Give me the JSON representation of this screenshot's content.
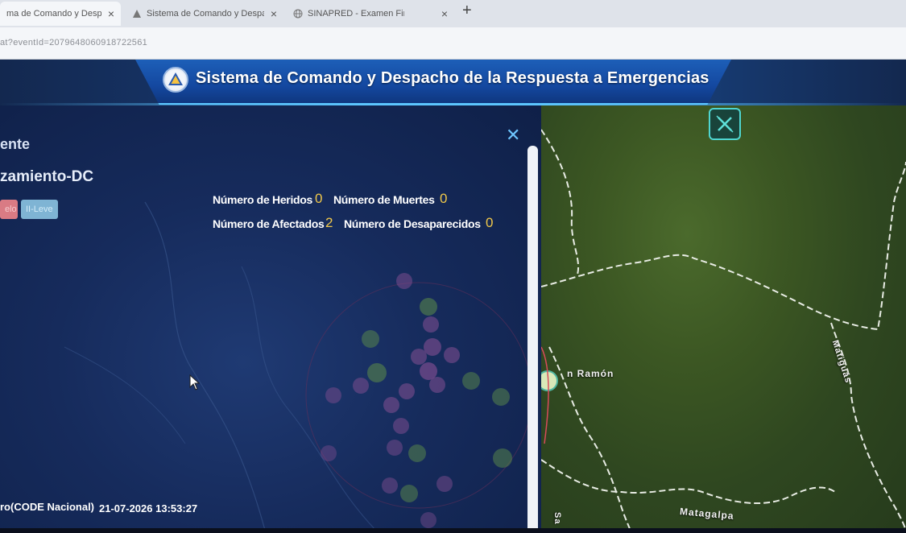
{
  "browser": {
    "tabs": [
      {
        "label": "ma de Comando y Despacho",
        "active": true,
        "favicon": "sinapred-icon"
      },
      {
        "label": "Sistema de Comando y Despacho",
        "active": false,
        "favicon": "sinapred-icon"
      },
      {
        "label": "SINAPRED - Examen Final",
        "active": false,
        "favicon": "globe-icon"
      }
    ],
    "tab_close_glyph": "×",
    "new_tab_glyph": "+",
    "address": "at?eventId=2079648060918722561"
  },
  "header": {
    "title": "Sistema de Comando y Despacho de la Respuesta a Emergencias",
    "logo_icon": "civil-defense-triangle-icon"
  },
  "panel": {
    "heading1": "ente",
    "heading2": "zamiento-DC",
    "chips": [
      "elo",
      "II-Leve"
    ],
    "stats": {
      "heridos_label": "Número de Heridos",
      "heridos_value": "0",
      "muertes_label": "Número de Muertes",
      "muertes_value": "0",
      "afectados_label": "Número de Afectados",
      "afectados_value": "2",
      "desaparecidos_label": "Número de Desaparecidos",
      "desaparecidos_value": "0"
    },
    "close_glyph": "✕",
    "footer_org": "ro(CODE Nacional)",
    "footer_datetime": "21-07-2026 13:53:27"
  },
  "map": {
    "labels": {
      "san_ramon": "n Ramón",
      "matiguas": "Matiguás",
      "matagalpa": "Matagalpa",
      "sa": "Sa"
    },
    "tool_icon": "measure-tool-icon"
  },
  "colors": {
    "accent": "#5cc6ff",
    "stat_value": "#f0c84a",
    "panel_bg": "#162b5c"
  }
}
